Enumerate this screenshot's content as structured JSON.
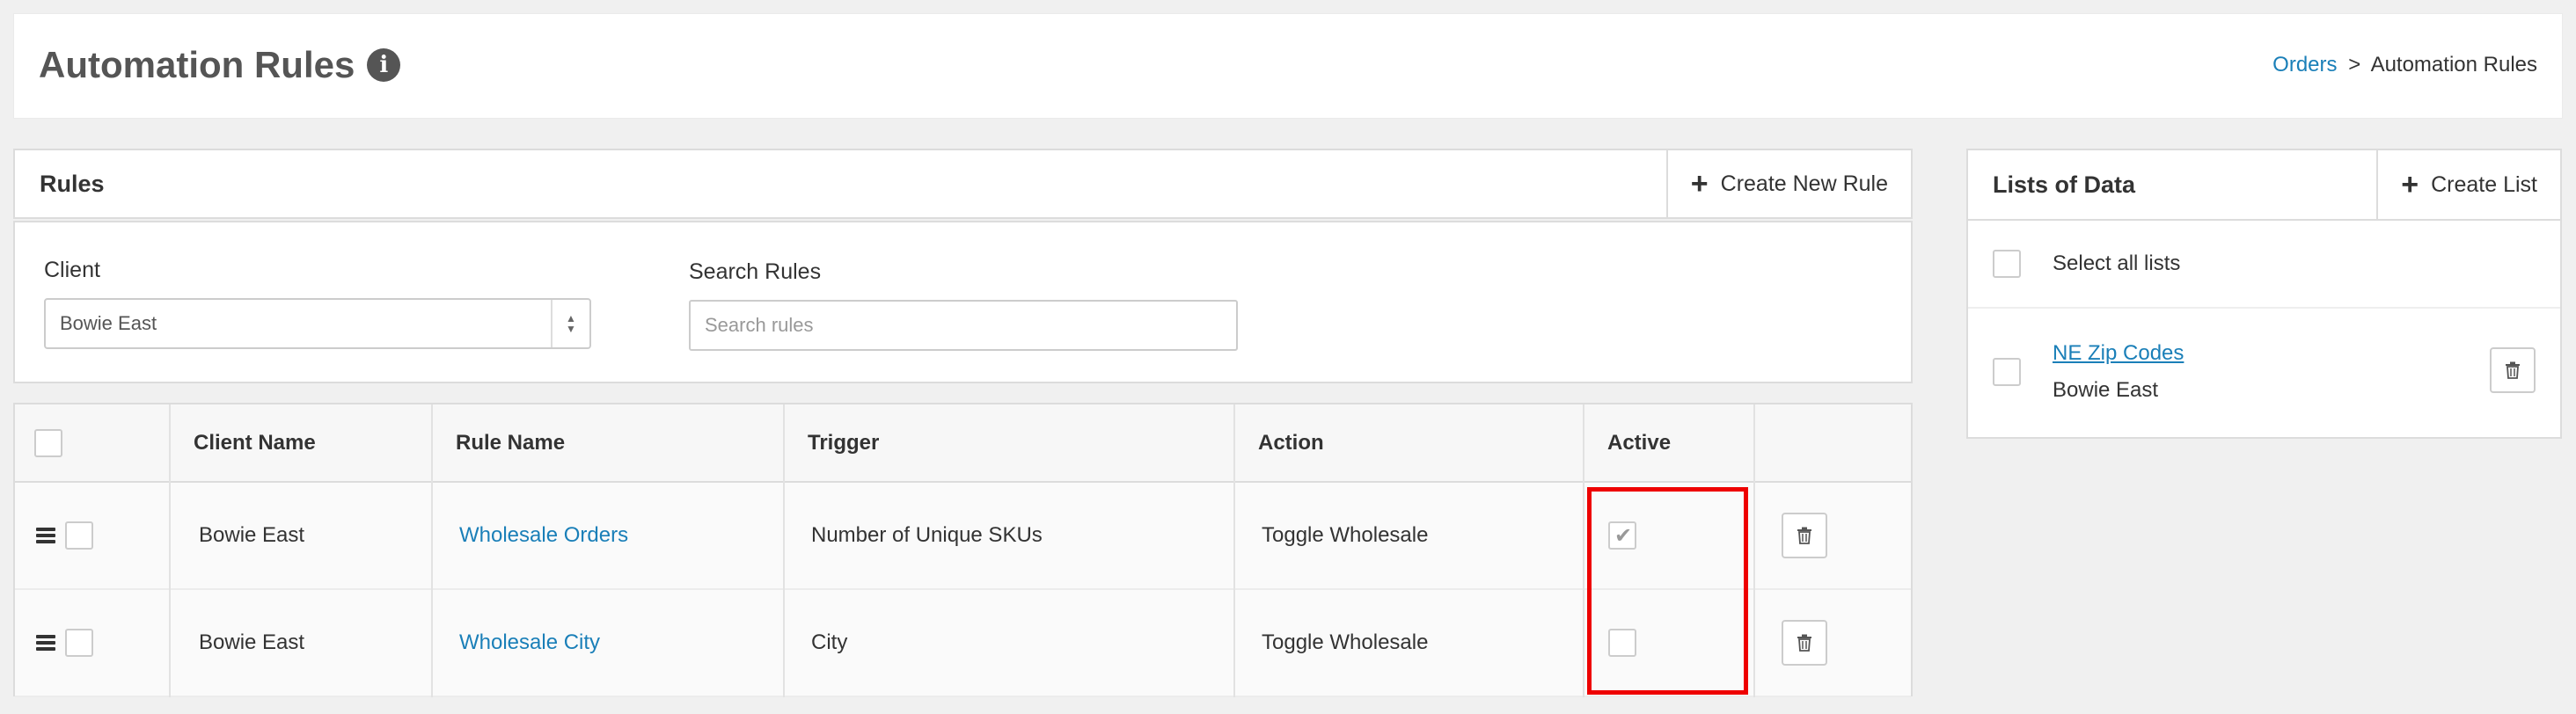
{
  "header": {
    "title": "Automation Rules",
    "info_icon": "i",
    "breadcrumb": {
      "parent": "Orders",
      "separator": ">",
      "current": "Automation Rules"
    }
  },
  "rules_panel": {
    "title": "Rules",
    "create_button": "Create New Rule",
    "plus_icon": "+"
  },
  "filters": {
    "client_label": "Client",
    "client_value": "Bowie East",
    "search_label": "Search Rules",
    "search_placeholder": "Search rules",
    "search_value": ""
  },
  "table": {
    "columns": [
      "",
      "Client Name",
      "Rule Name",
      "Trigger",
      "Action",
      "Active",
      ""
    ],
    "rows": [
      {
        "client": "Bowie East",
        "rule": "Wholesale Orders",
        "trigger": "Number of Unique SKUs",
        "action": "Toggle Wholesale",
        "active": true
      },
      {
        "client": "Bowie East",
        "rule": "Wholesale City",
        "trigger": "City",
        "action": "Toggle Wholesale",
        "active": false
      }
    ]
  },
  "lists_panel": {
    "title": "Lists of Data",
    "create_button": "Create List",
    "select_all_label": "Select all lists",
    "items": [
      {
        "name": "NE Zip Codes",
        "client": "Bowie East"
      }
    ]
  },
  "colors": {
    "link": "#1a7fb8",
    "highlight": "#ee0000",
    "title": "#555555"
  },
  "icons": [
    "info-icon",
    "plus-icon",
    "drag-handle-icon",
    "trash-icon",
    "checkmark-icon",
    "select-arrows-icon"
  ]
}
